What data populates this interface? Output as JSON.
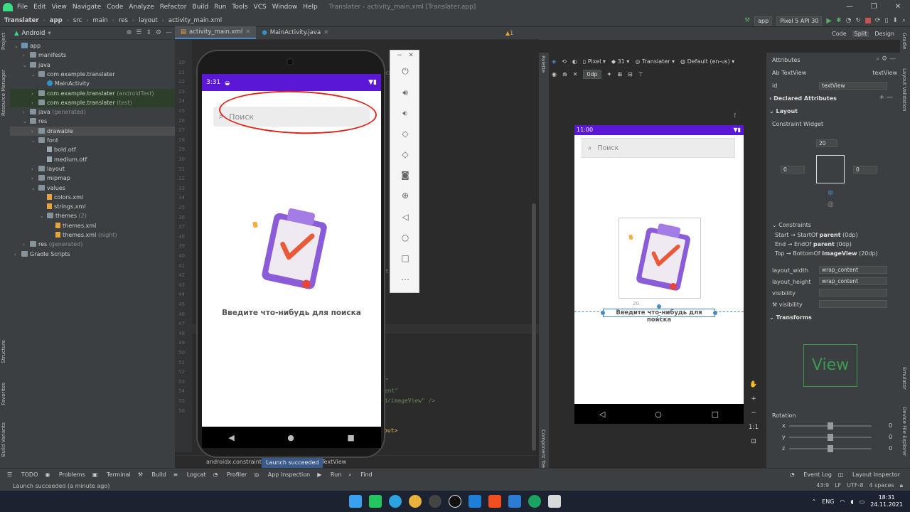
{
  "menu": {
    "items": [
      "File",
      "Edit",
      "View",
      "Navigate",
      "Code",
      "Analyze",
      "Refactor",
      "Build",
      "Run",
      "Tools",
      "VCS",
      "Window",
      "Help"
    ],
    "window_title": "Translater - activity_main.xml [Translater.app]"
  },
  "nav": {
    "crumbs": [
      "Translater",
      "app",
      "src",
      "main",
      "res",
      "layout",
      "activity_main.xml"
    ],
    "run_config": "app",
    "device": "Pixel 5 API 30"
  },
  "project": {
    "view_mode": "Android",
    "tree": [
      {
        "label": "app",
        "depth": 0,
        "icon": "folder-b"
      },
      {
        "label": "manifests",
        "depth": 1,
        "icon": "folder"
      },
      {
        "label": "java",
        "depth": 1,
        "icon": "folder"
      },
      {
        "label": "com.example.translater",
        "depth": 2,
        "icon": "folder"
      },
      {
        "label": "MainActivity",
        "depth": 3,
        "icon": "class"
      },
      {
        "label": "com.example.translater",
        "depth": 2,
        "icon": "folder",
        "suffix": "(androidTest)",
        "hl": "green"
      },
      {
        "label": "com.example.translater",
        "depth": 2,
        "icon": "folder",
        "suffix": "(test)",
        "hl": "green"
      },
      {
        "label": "java",
        "depth": 1,
        "icon": "folder",
        "suffix": "(generated)"
      },
      {
        "label": "res",
        "depth": 1,
        "icon": "folder"
      },
      {
        "label": "drawable",
        "depth": 2,
        "icon": "folder",
        "hl": "sel"
      },
      {
        "label": "font",
        "depth": 2,
        "icon": "folder"
      },
      {
        "label": "bold.otf",
        "depth": 3,
        "icon": "file"
      },
      {
        "label": "medium.otf",
        "depth": 3,
        "icon": "file"
      },
      {
        "label": "layout",
        "depth": 2,
        "icon": "folder"
      },
      {
        "label": "mipmap",
        "depth": 2,
        "icon": "folder"
      },
      {
        "label": "values",
        "depth": 2,
        "icon": "folder"
      },
      {
        "label": "colors.xml",
        "depth": 3,
        "icon": "xml"
      },
      {
        "label": "strings.xml",
        "depth": 3,
        "icon": "xml"
      },
      {
        "label": "themes",
        "depth": 3,
        "icon": "folder",
        "suffix": "(2)"
      },
      {
        "label": "themes.xml",
        "depth": 4,
        "icon": "xml"
      },
      {
        "label": "themes.xml",
        "depth": 4,
        "icon": "xml",
        "suffix": "(night)"
      },
      {
        "label": "res",
        "depth": 1,
        "icon": "folder",
        "suffix": "(generated)"
      },
      {
        "label": "Gradle Scripts",
        "depth": 0,
        "icon": "folder"
      }
    ]
  },
  "editor": {
    "tabs": [
      "activity_main.xml",
      "MainActivity.java"
    ],
    "line_numbers": [
      "20",
      "21",
      "22",
      "23",
      "24",
      "25",
      "26",
      "27",
      "28",
      "29",
      "30",
      "31",
      "32",
      "33",
      "34",
      "35",
      "36",
      "37",
      "38",
      "39",
      "40",
      "41",
      "42",
      "43",
      "44",
      "45",
      "46",
      "47",
      "48",
      "49",
      "50",
      "51",
      "52",
      "53",
      "54",
      "55",
      "56"
    ],
    "warning_count": "1",
    "code_fragments": [
      "ch_24\"",
      "\"",
      "rent\"",
      "d/imageView\" />",
      "out>",
      "t\""
    ],
    "breadcrumb": [
      "androidx.constraintla",
      "layout",
      "TextView"
    ],
    "launch_toast": "Launch succeeded"
  },
  "emulator": {
    "time": "3:31",
    "search_placeholder": "Поиск",
    "caption": "Введите что-нибудь для поиска"
  },
  "design": {
    "modes": [
      "Code",
      "Split",
      "Design"
    ],
    "device": "Pixel",
    "api": "31",
    "theme": "Translater",
    "locale": "Default (en-us)",
    "margin_value": "0dp",
    "time": "11:00",
    "search_placeholder": "Поиск",
    "caption": "Введите что-нибудь для поиска",
    "margin_top": "20",
    "palette_label": "Palette",
    "component_tree_label": "Component Tree",
    "zoom_ratio": "1:1"
  },
  "attributes": {
    "title": "Attributes",
    "widget_type": "TextView",
    "widget_name": "textView",
    "id_label": "id",
    "id_value": "textView",
    "declared": "Declared Attributes",
    "layout": "Layout",
    "constraint_widget": "Constraint Widget",
    "top_margin": "20",
    "left_margin": "0",
    "right_margin": "0",
    "constraints_title": "Constraints",
    "constraints": [
      {
        "pre": "Start → StartOf ",
        "bold": "parent",
        "post": " (0dp)"
      },
      {
        "pre": "End → EndOf ",
        "bold": "parent",
        "post": " (0dp)"
      },
      {
        "pre": "Top → BottomOf ",
        "bold": "imageView",
        "post": " (20dp)"
      }
    ],
    "rows": [
      {
        "label": "layout_width",
        "value": "wrap_content"
      },
      {
        "label": "layout_height",
        "value": "wrap_content"
      },
      {
        "label": "visibility",
        "value": ""
      },
      {
        "label": "visibility",
        "value": ""
      }
    ],
    "transforms": "Transforms",
    "view_preview": "View",
    "rotation": "Rotation",
    "axes": [
      {
        "axis": "x",
        "value": "0"
      },
      {
        "axis": "y",
        "value": "0"
      },
      {
        "axis": "z",
        "value": "0"
      }
    ]
  },
  "left_tabs": [
    "Project",
    "Resource Manager",
    "Structure",
    "Favorites",
    "Build Variants"
  ],
  "right_tabs": [
    "Gradle",
    "Layout Validation",
    "Emulator",
    "Device File Explorer"
  ],
  "bottom_tools": [
    "TODO",
    "Problems",
    "Terminal",
    "Build",
    "Logcat",
    "Profiler",
    "App Inspection",
    "Run",
    "Find"
  ],
  "bottom_right": [
    "Event Log",
    "Layout Inspector"
  ],
  "status": {
    "message": "Launch succeeded (a minute ago)",
    "position": "43:9",
    "line_sep": "LF",
    "encoding": "UTF-8",
    "indent": "4 spaces"
  },
  "taskbar": {
    "lang": "ENG",
    "time": "18:31",
    "date": "24.11.2021"
  }
}
